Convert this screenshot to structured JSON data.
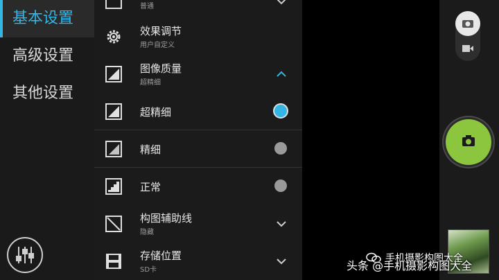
{
  "nav": {
    "items": [
      {
        "label": "基本设置",
        "active": true
      },
      {
        "label": "高级设置",
        "active": false
      },
      {
        "label": "其他设置",
        "active": false
      }
    ],
    "tune_icon": "sliders-icon"
  },
  "settings": {
    "top_partial": {
      "sub": "普通",
      "icon": "scene-icon"
    },
    "effects": {
      "title": "效果调节",
      "sub": "用户自定义",
      "icon": "gear-icon"
    },
    "quality": {
      "title": "图像质量",
      "sub": "超精细",
      "icon": "quality-icon",
      "expanded": true
    },
    "quality_options": [
      {
        "label": "超精细",
        "selected": true
      },
      {
        "label": "精细",
        "selected": false
      },
      {
        "label": "正常",
        "selected": false
      }
    ],
    "grid": {
      "title": "构图辅助线",
      "sub": "隐藏",
      "icon": "grid-lines-icon"
    },
    "storage": {
      "title": "存储位置",
      "sub": "SD卡",
      "icon": "save-icon"
    }
  },
  "camera": {
    "accent": "#8cc63f",
    "mode_photo_icon": "camera-icon",
    "mode_video_icon": "video-camera-icon",
    "shutter_icon": "camera-icon"
  },
  "watermark": {
    "top": "手机摄影构图大全",
    "bottom": "头条 @手机摄影构图大全"
  },
  "colors": {
    "accent": "#33b5e5",
    "panel": "#1b1b1b"
  }
}
